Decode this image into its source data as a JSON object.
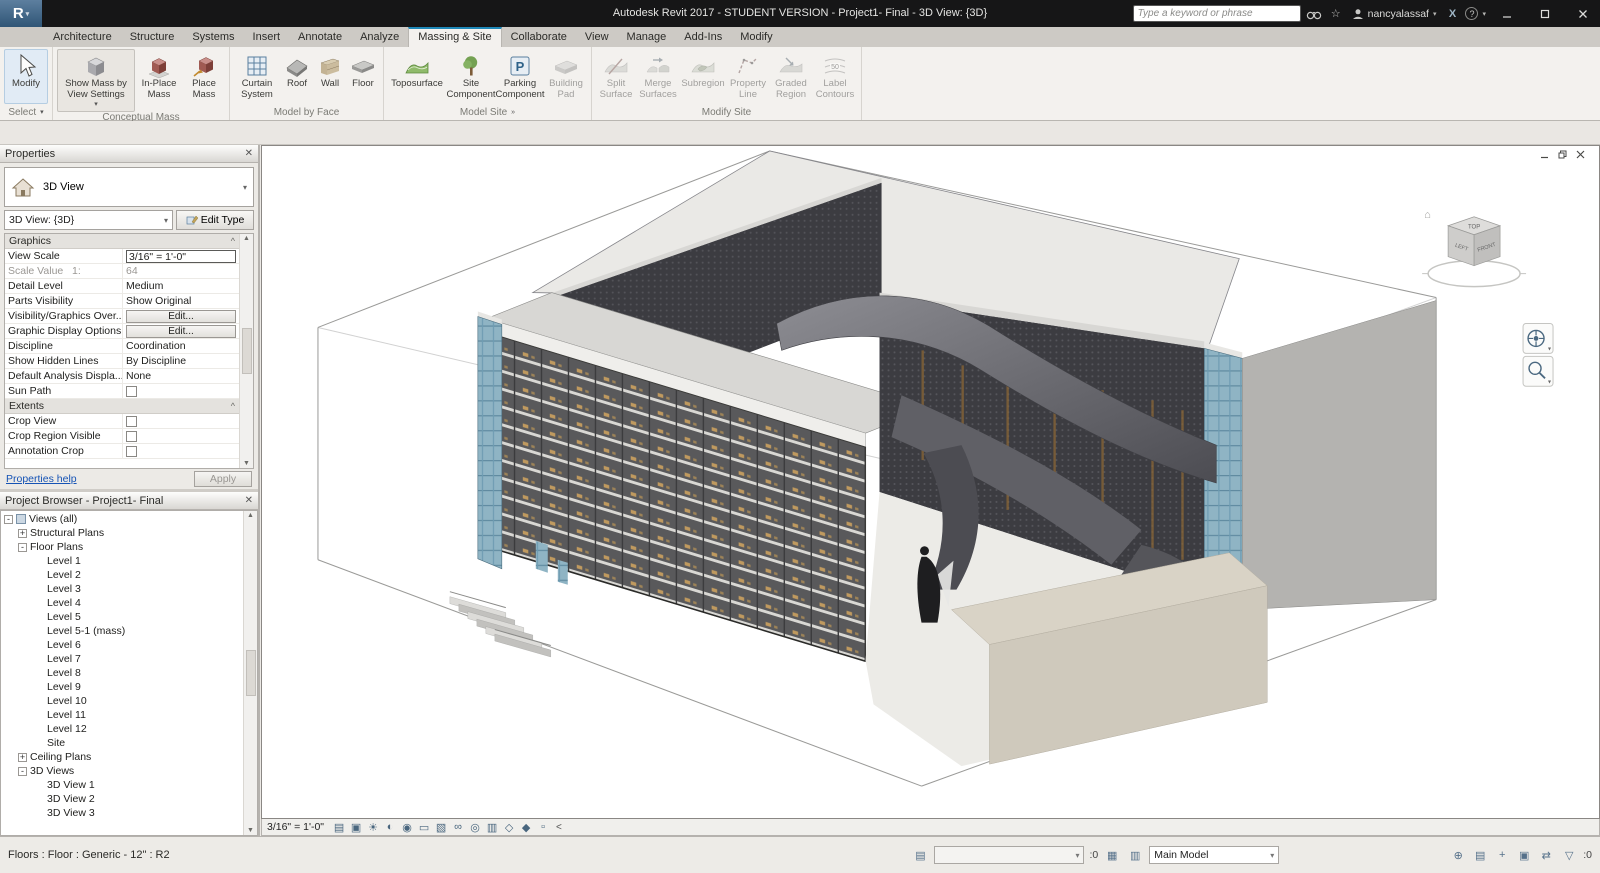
{
  "titlebar": {
    "logo_letter": "R",
    "title": "Autodesk Revit 2017 - STUDENT VERSION -   Project1- Final - 3D View: {3D}",
    "search_placeholder": "Type a keyword or phrase",
    "user": "nancyalassaf"
  },
  "icons": {
    "dropdown": "▾",
    "close": "✕",
    "help": "?",
    "collapse": "^",
    "up": "▲",
    "down": "▼",
    "worksets": "▤",
    "design_options": "▦",
    "options2": "▥",
    "filter": "▽",
    "vcb_collapse": "<",
    "home": "⌂",
    "star": "☆",
    "exchange": "X"
  },
  "ribbon": {
    "tabs": [
      {
        "label": "Architecture",
        "active": false
      },
      {
        "label": "Structure",
        "active": false
      },
      {
        "label": "Systems",
        "active": false
      },
      {
        "label": "Insert",
        "active": false
      },
      {
        "label": "Annotate",
        "active": false
      },
      {
        "label": "Analyze",
        "active": false
      },
      {
        "label": "Massing & Site",
        "active": true
      },
      {
        "label": "Collaborate",
        "active": false
      },
      {
        "label": "View",
        "active": false
      },
      {
        "label": "Manage",
        "active": false
      },
      {
        "label": "Add-Ins",
        "active": false
      },
      {
        "label": "Modify",
        "active": false
      }
    ],
    "panels": [
      {
        "caption": "Select",
        "buttons": [
          {
            "label": "Modify"
          }
        ]
      },
      {
        "caption": "Conceptual Mass",
        "buttons": [
          {
            "label": "Show Mass by View Settings"
          },
          {
            "label": "In-Place Mass"
          },
          {
            "label": "Place Mass"
          }
        ]
      },
      {
        "caption": "Model by Face",
        "buttons": [
          {
            "label": "Curtain System"
          },
          {
            "label": "Roof"
          },
          {
            "label": "Wall"
          },
          {
            "label": "Floor"
          }
        ]
      },
      {
        "caption": "Model Site",
        "buttons": [
          {
            "label": "Toposurface"
          },
          {
            "label": "Site Component"
          },
          {
            "label": "Parking Component"
          },
          {
            "label": "Building Pad"
          }
        ]
      },
      {
        "caption": "Modify Site",
        "buttons": [
          {
            "label": "Split Surface"
          },
          {
            "label": "Merge Surfaces"
          },
          {
            "label": "Subregion"
          },
          {
            "label": "Property Line"
          },
          {
            "label": "Graded Region"
          },
          {
            "label": "Label Contours"
          }
        ]
      }
    ]
  },
  "properties": {
    "header": "Properties",
    "type_label": "3D View",
    "instance_combo": "3D View: {3D}",
    "edit_type": "Edit Type",
    "graphics_title": "Graphics",
    "graphics_rows": [
      {
        "label": "View Scale",
        "value": "3/16\" = 1'-0\""
      },
      {
        "label": "Scale Value   1:",
        "value": "64"
      },
      {
        "label": "Detail Level",
        "value": "Medium"
      },
      {
        "label": "Parts Visibility",
        "value": "Show Original"
      },
      {
        "label": "Visibility/Graphics Over...",
        "value": "Edit..."
      },
      {
        "label": "Graphic Display Options",
        "value": "Edit..."
      },
      {
        "label": "Discipline",
        "value": "Coordination"
      },
      {
        "label": "Show Hidden Lines",
        "value": "By Discipline"
      },
      {
        "label": "Default Analysis Displa...",
        "value": "None"
      },
      {
        "label": "Sun Path",
        "value": ""
      }
    ],
    "extents_title": "Extents",
    "extents_rows": [
      {
        "label": "Crop View",
        "value": ""
      },
      {
        "label": "Crop Region Visible",
        "value": ""
      },
      {
        "label": "Annotation Crop",
        "value": ""
      }
    ],
    "help_link": "Properties help",
    "apply": "Apply"
  },
  "project_browser": {
    "header": "Project Browser - Project1- Final",
    "tree": [
      {
        "label": "Views (all)",
        "level": 0,
        "exp": "-"
      },
      {
        "label": "Structural Plans",
        "level": 1,
        "exp": "+"
      },
      {
        "label": "Floor Plans",
        "level": 1,
        "exp": "-"
      },
      {
        "label": "Level 1",
        "level": 2,
        "exp": ""
      },
      {
        "label": "Level 2",
        "level": 2,
        "exp": ""
      },
      {
        "label": "Level 3",
        "level": 2,
        "exp": ""
      },
      {
        "label": "Level 4",
        "level": 2,
        "exp": ""
      },
      {
        "label": "Level 5",
        "level": 2,
        "exp": ""
      },
      {
        "label": "Level 5-1 (mass)",
        "level": 2,
        "exp": ""
      },
      {
        "label": "Level 6",
        "level": 2,
        "exp": ""
      },
      {
        "label": "Level 7",
        "level": 2,
        "exp": ""
      },
      {
        "label": "Level 8",
        "level": 2,
        "exp": ""
      },
      {
        "label": "Level 9",
        "level": 2,
        "exp": ""
      },
      {
        "label": "Level 10",
        "level": 2,
        "exp": ""
      },
      {
        "label": "Level 11",
        "level": 2,
        "exp": ""
      },
      {
        "label": "Level 12",
        "level": 2,
        "exp": ""
      },
      {
        "label": "Site",
        "level": 2,
        "exp": ""
      },
      {
        "label": "Ceiling Plans",
        "level": 1,
        "exp": "+"
      },
      {
        "label": "3D Views",
        "level": 1,
        "exp": "-"
      },
      {
        "label": "3D View 1",
        "level": 2,
        "exp": ""
      },
      {
        "label": "3D View 2",
        "level": 2,
        "exp": ""
      },
      {
        "label": "3D View 3",
        "level": 2,
        "exp": ""
      }
    ]
  },
  "viewcube": {
    "top": "TOP",
    "front": "FRONT",
    "left": "LEFT"
  },
  "vcb": {
    "scale": "3/16\" = 1'-0\"",
    "collapse": "<",
    "icons": [
      {
        "name": "detail-level-icon",
        "glyph": "▤"
      },
      {
        "name": "visual-style-icon",
        "glyph": "▣"
      },
      {
        "name": "sun-path-icon",
        "glyph": "☀"
      },
      {
        "name": "shadows-icon",
        "glyph": "◐"
      },
      {
        "name": "render-icon",
        "glyph": "◉"
      },
      {
        "name": "crop-view-icon",
        "glyph": "▭"
      },
      {
        "name": "crop-region-icon",
        "glyph": "▧"
      },
      {
        "name": "hide-isolate-icon",
        "glyph": "∞"
      },
      {
        "name": "reveal-hidden-icon",
        "glyph": "◎"
      },
      {
        "name": "view-properties-icon",
        "glyph": "▥"
      },
      {
        "name": "analytical-model-icon",
        "glyph": "◇"
      },
      {
        "name": "displacement-icon",
        "glyph": "◆"
      },
      {
        "name": "constraints-icon",
        "glyph": "▫"
      }
    ]
  },
  "statusbar": {
    "selection": "Floors : Floor : Generic - 12\" : R2",
    "editable_count": ":0",
    "active_workset": "",
    "design_option": "Main Model",
    "filter_count": ":0",
    "cluster": [
      {
        "name": "select-links-icon",
        "glyph": "⊕"
      },
      {
        "name": "select-underlay-icon",
        "glyph": "▤"
      },
      {
        "name": "select-pinned-icon",
        "glyph": "+"
      },
      {
        "name": "select-by-face-icon",
        "glyph": "▣"
      },
      {
        "name": "drag-on-selection-icon",
        "glyph": "⇄"
      }
    ]
  }
}
